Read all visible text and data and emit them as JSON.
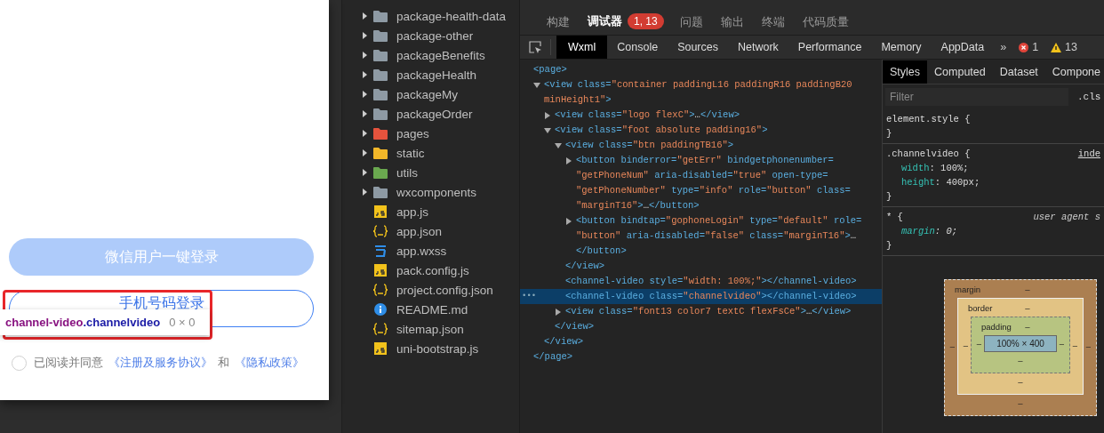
{
  "simulator": {
    "buttons": [
      {
        "label": "微信用户一键登录",
        "kind": "primary"
      },
      {
        "label": "手机号码登录",
        "kind": "outline"
      }
    ],
    "inspect_tooltip": {
      "tag": "channel-video",
      "class_name": ".channelvideo",
      "size": "0 × 0"
    },
    "agreement": {
      "checked": false,
      "parts": [
        {
          "text": "已阅读并同意",
          "kind": "plain"
        },
        {
          "text": "《注册及服务协议》",
          "kind": "link"
        },
        {
          "text": "和",
          "kind": "plain"
        },
        {
          "text": "《隐私政策》",
          "kind": "link"
        }
      ]
    }
  },
  "file_tree": {
    "items": [
      {
        "name": "package-health-data",
        "kind": "folder",
        "expanded": false,
        "color": "#8e9aa4"
      },
      {
        "name": "package-other",
        "kind": "folder",
        "expanded": false,
        "color": "#8e9aa4"
      },
      {
        "name": "packageBenefits",
        "kind": "folder",
        "expanded": false,
        "color": "#8e9aa4"
      },
      {
        "name": "packageHealth",
        "kind": "folder",
        "expanded": false,
        "color": "#8e9aa4"
      },
      {
        "name": "packageMy",
        "kind": "folder",
        "expanded": false,
        "color": "#8e9aa4"
      },
      {
        "name": "packageOrder",
        "kind": "folder",
        "expanded": false,
        "color": "#8e9aa4"
      },
      {
        "name": "pages",
        "kind": "folder",
        "expanded": false,
        "color": "#e5533d"
      },
      {
        "name": "static",
        "kind": "folder",
        "expanded": false,
        "color": "#f2b729"
      },
      {
        "name": "utils",
        "kind": "folder",
        "expanded": false,
        "color": "#6aa84f"
      },
      {
        "name": "wxcomponents",
        "kind": "folder",
        "expanded": false,
        "color": "#8e9aa4"
      },
      {
        "name": "app.js",
        "kind": "js"
      },
      {
        "name": "app.json",
        "kind": "json"
      },
      {
        "name": "app.wxss",
        "kind": "css"
      },
      {
        "name": "pack.config.js",
        "kind": "js"
      },
      {
        "name": "project.config.json",
        "kind": "json"
      },
      {
        "name": "README.md",
        "kind": "info"
      },
      {
        "name": "sitemap.json",
        "kind": "json"
      },
      {
        "name": "uni-bootstrap.js",
        "kind": "js"
      }
    ]
  },
  "devtools": {
    "panel_tabs": [
      {
        "label": "构建",
        "selected": false
      },
      {
        "label": "调试器",
        "selected": true,
        "badge": "1, 13"
      },
      {
        "label": "问题",
        "selected": false
      },
      {
        "label": "输出",
        "selected": false
      },
      {
        "label": "终端",
        "selected": false
      },
      {
        "label": "代码质量",
        "selected": false
      }
    ],
    "tool_tabs": [
      {
        "label": "Wxml",
        "selected": true
      },
      {
        "label": "Console",
        "selected": false
      },
      {
        "label": "Sources",
        "selected": false
      },
      {
        "label": "Network",
        "selected": false
      },
      {
        "label": "Performance",
        "selected": false
      },
      {
        "label": "Memory",
        "selected": false
      },
      {
        "label": "AppData",
        "selected": false
      }
    ],
    "more": "»",
    "errors": "1",
    "warnings": "13",
    "wxml": [
      {
        "kind": "leaf",
        "selected": false,
        "lines": [
          "<page>"
        ],
        "close": "</page>",
        "children": [
          {
            "kind": "element",
            "expanded": true,
            "selected": false,
            "lines": [
              "<view class=\"container paddingL16 paddingR16 paddingB20",
              "minHeight1\">"
            ],
            "close": "</view>",
            "children": [
              {
                "kind": "element",
                "expanded": false,
                "selected": false,
                "lines": [
                  "<view class=\"logo flexC\">…</view>"
                ]
              },
              {
                "kind": "element",
                "expanded": true,
                "selected": false,
                "lines": [
                  "<view class=\"foot absolute padding16\">"
                ],
                "close": "</view>",
                "children": [
                  {
                    "kind": "element",
                    "expanded": true,
                    "selected": false,
                    "lines": [
                      "<view class=\"btn paddingTB16\">"
                    ],
                    "close": "</view>",
                    "children": [
                      {
                        "kind": "element",
                        "expanded": false,
                        "selected": false,
                        "lines": [
                          "<button binderror=\"getErr\" bindgetphonenumber=",
                          "\"getPhoneNum\" aria-disabled=\"true\" open-type=",
                          "\"getPhoneNumber\" type=\"info\" role=\"button\" class=",
                          "\"marginT16\">…</button>"
                        ]
                      },
                      {
                        "kind": "element",
                        "expanded": false,
                        "selected": false,
                        "lines": [
                          "<button bindtap=\"gophoneLogin\" type=\"default\" role=",
                          "\"button\" aria-disabled=\"false\" class=\"marginT16\">…",
                          "</button>"
                        ]
                      }
                    ]
                  },
                  {
                    "kind": "leaf",
                    "selected": false,
                    "lines": [
                      "<channel-video style=\"width: 100%;\"></channel-video>"
                    ]
                  },
                  {
                    "kind": "leaf",
                    "selected": true,
                    "lines": [
                      "<channel-video class=\"channelvideo\"></channel-video>"
                    ]
                  },
                  {
                    "kind": "element",
                    "expanded": false,
                    "selected": false,
                    "lines": [
                      "<view class=\"font13 color7 textC flexFsCe\">…</view>"
                    ]
                  }
                ]
              }
            ]
          }
        ]
      }
    ],
    "selected_marker": "•••",
    "styles": {
      "tabs": [
        {
          "label": "Styles",
          "selected": true
        },
        {
          "label": "Computed",
          "selected": false
        },
        {
          "label": "Dataset",
          "selected": false
        },
        {
          "label": "Compone",
          "selected": false
        }
      ],
      "filter": {
        "placeholder": "Filter"
      },
      "cls": ".cls",
      "rules": [
        {
          "kind": "inline",
          "selector": "element.style {",
          "close": "}"
        },
        {
          "kind": "author",
          "selector": ".channelvideo {",
          "source": "inde",
          "declarations": [
            "width: 100%;",
            "height: 400px;"
          ],
          "close": "}"
        },
        {
          "kind": "user-agent",
          "selector": "* {",
          "source": "user agent s",
          "declarations": [
            "margin: 0;"
          ],
          "close": "}"
        }
      ],
      "box_model": {
        "layers": [
          {
            "label": "margin",
            "top": "–"
          },
          {
            "label": "border",
            "top": "–"
          },
          {
            "label": "padding",
            "top": "–"
          }
        ],
        "left_values": [
          "–",
          "–",
          "–"
        ],
        "content": "100% × 400",
        "right_values": [
          "–",
          "–",
          "–"
        ],
        "bottom_values": [
          "–",
          "–",
          "–"
        ]
      }
    }
  }
}
